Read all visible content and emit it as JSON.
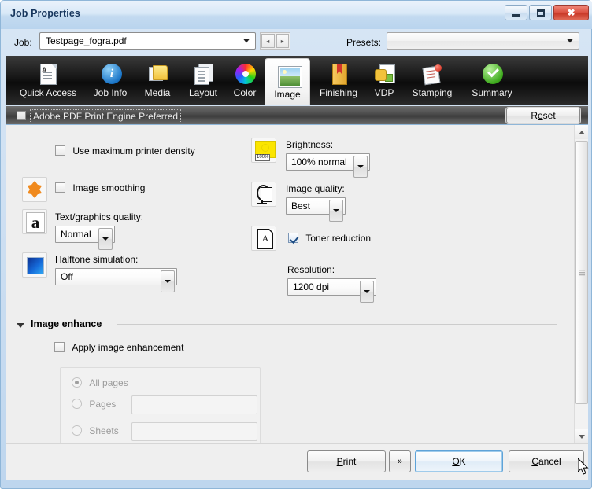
{
  "window": {
    "title": "Job Properties",
    "buttons": {
      "minimize": "minimize-button",
      "maximize": "maximize-button",
      "close": "close-button"
    }
  },
  "jobbar": {
    "job_label": "Job:",
    "job_value": "Testpage_fogra.pdf",
    "nav_prev": "◂",
    "nav_next": "▸",
    "presets_label": "Presets:",
    "presets_value": ""
  },
  "tabs": [
    {
      "label": "Quick Access",
      "icon": "document-text-icon",
      "active": false
    },
    {
      "label": "Job Info",
      "icon": "info-circle-icon",
      "active": false
    },
    {
      "label": "Media",
      "icon": "folder-media-icon",
      "active": false
    },
    {
      "label": "Layout",
      "icon": "pages-layout-icon",
      "active": false
    },
    {
      "label": "Color",
      "icon": "color-wheel-icon",
      "active": false
    },
    {
      "label": "Image",
      "icon": "picture-icon",
      "active": true
    },
    {
      "label": "Finishing",
      "icon": "bookmark-finishing-icon",
      "active": false
    },
    {
      "label": "VDP",
      "icon": "variable-data-icon",
      "active": false
    },
    {
      "label": "Stamping",
      "icon": "stamp-icon",
      "active": false
    },
    {
      "label": "Summary",
      "icon": "green-check-icon",
      "active": false
    }
  ],
  "appe": {
    "checkbox_label": "Adobe PDF Print Engine Preferred",
    "checked": false,
    "reset_label": "Reset",
    "reset_accel": "e"
  },
  "image_panel": {
    "max_density": {
      "label": "Use maximum printer density",
      "checked": false
    },
    "image_smoothing": {
      "label": "Image smoothing",
      "checked": false,
      "icon": "smoothing-diamond-icon"
    },
    "text_graphics_quality": {
      "label": "Text/graphics quality:",
      "value": "Normal",
      "icon": "letter-a-icon"
    },
    "halftone_simulation": {
      "label": "Halftone simulation:",
      "value": "Off",
      "icon": "halftone-gradient-icon"
    },
    "brightness": {
      "label": "Brightness:",
      "value": "100% normal",
      "icon": "brightness-icon",
      "icon_tag": "100%"
    },
    "image_quality": {
      "label": "Image quality:",
      "value": "Best",
      "icon": "image-quality-icon"
    },
    "toner_reduction": {
      "label": "Toner reduction",
      "checked": true,
      "icon": "toner-page-icon"
    },
    "resolution": {
      "label": "Resolution:",
      "value": "1200 dpi"
    }
  },
  "image_enhance": {
    "section_title": "Image enhance",
    "expanded": true,
    "apply_label": "Apply image enhancement",
    "apply_checked": false,
    "options": [
      {
        "label": "All pages",
        "selected": true,
        "field": null
      },
      {
        "label": "Pages",
        "selected": false,
        "field": ""
      },
      {
        "label": "Sheets",
        "selected": false,
        "field": ""
      }
    ]
  },
  "scrollbar": {
    "up": "▲",
    "down": "▼",
    "position_percent": 0
  },
  "footer": {
    "print_label": "Print",
    "print_accel": "P",
    "more_label": "»",
    "ok_label": "OK",
    "ok_accel": "O",
    "cancel_label": "Cancel",
    "cancel_accel": "C"
  },
  "colors": {
    "window_border": "#8fb6d8",
    "title_text": "#17365d",
    "tabstrip_bg": "#161616",
    "accent": "#5ea3d8",
    "close_red": "#c73524"
  }
}
